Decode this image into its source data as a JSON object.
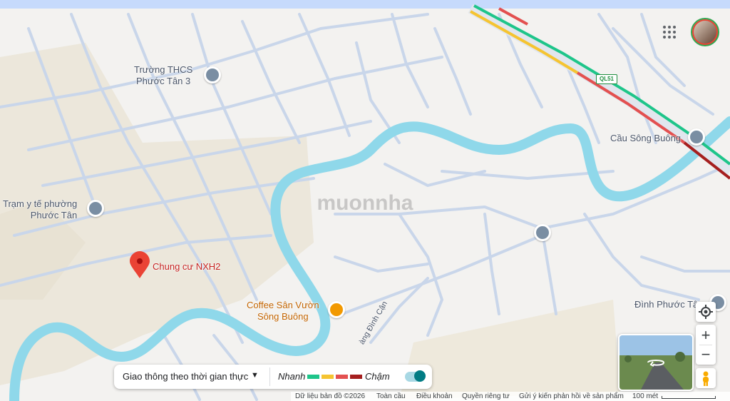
{
  "map": {
    "watermark": "muonnha",
    "places": {
      "school": "Trường THCS\nPhước Tân 3",
      "clinic": "Trạm y tế phường\nPhước Tân",
      "selected": "Chung cư NXH2",
      "coffee": "Coffee Sân Vườn\nSông Buông",
      "bridge": "Cầu Sông Buông",
      "temple": "Đình Phước Tâ",
      "street": "àng Đình Cận"
    },
    "road_shield": "QL51"
  },
  "traffic": {
    "mode_label": "Giao thông theo thời gian thực",
    "fast_label": "Nhanh",
    "slow_label": "Chậm",
    "legend_colors": [
      "#1ec58a",
      "#f5c431",
      "#e35050",
      "#a51f1f"
    ],
    "toggle_on": true
  },
  "controls": {
    "zoom_in": "+",
    "zoom_out": "−"
  },
  "footer": {
    "map_data": "Dữ liệu bản đồ ©2026",
    "global": "Toàn cầu",
    "terms": "Điều khoản",
    "privacy": "Quyền riêng tư",
    "feedback": "Gửi ý kiến phản hồi về sản phẩm",
    "scale": "100 mét"
  },
  "colors": {
    "water": "#8fd8ea",
    "land_built": "#ece7db",
    "road": "#c5d3e8",
    "accent_pin": "#ea4335",
    "traffic_green": "#1ec58a"
  }
}
